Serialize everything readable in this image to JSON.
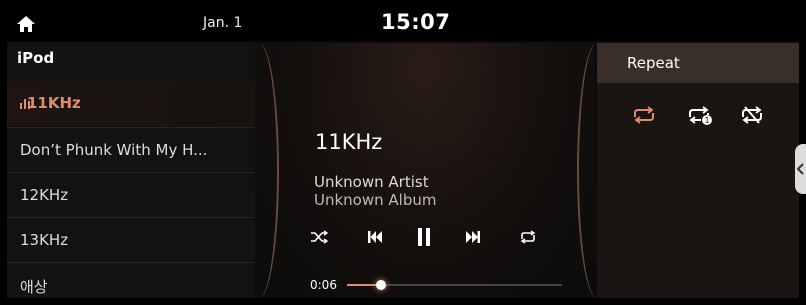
{
  "status_bar": {
    "date": "Jan. 1",
    "time": "15:07"
  },
  "playlist": {
    "source": "iPod",
    "items": [
      {
        "label": "11KHz",
        "active": true
      },
      {
        "label": "Don’t Phunk With My H...",
        "active": false
      },
      {
        "label": "12KHz",
        "active": false
      },
      {
        "label": "13KHz",
        "active": false
      },
      {
        "label": "애상",
        "active": false
      }
    ]
  },
  "now_playing": {
    "title": "11KHz",
    "artist": "Unknown Artist",
    "album": "Unknown Album",
    "elapsed": "0:06",
    "progress_fraction": 0.16
  },
  "repeat_menu": {
    "title": "Repeat",
    "options": [
      "repeat-all-icon",
      "repeat-one-icon",
      "repeat-off-icon"
    ]
  },
  "colors": {
    "accent": "#e08a6e",
    "panel": "#1a1512",
    "header": "#3a2e28"
  }
}
